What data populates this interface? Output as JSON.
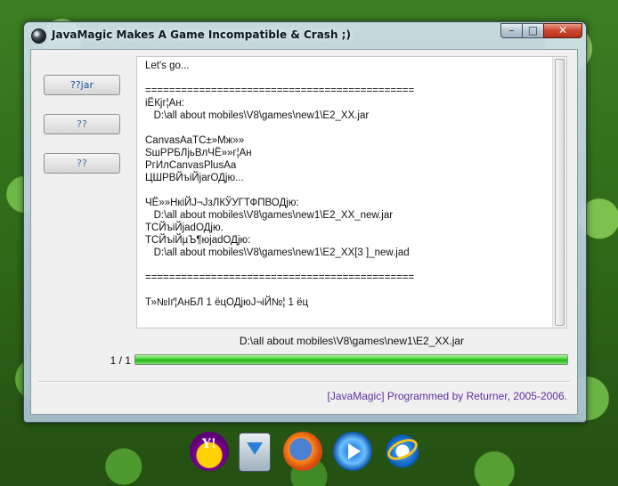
{
  "window": {
    "title": "JavaMagic Makes A Game Incompatible & Crash ;)",
    "controls": {
      "minimize": "–",
      "maximize": "□",
      "close": "✕"
    }
  },
  "sidebar": {
    "buttons": [
      {
        "label": "??jar"
      },
      {
        "label": "??"
      },
      {
        "label": "??"
      }
    ]
  },
  "log": {
    "lines": [
      "Let's go...",
      "",
      "=============================================",
      "іЁКјг¦Ан:",
      "   D:\\all about mobiles\\V8\\games\\new1\\E2_XX.jar",
      "",
      "CanvasAaTC±»Мж»»",
      "SшРРБЛјьВлЧЁ»»г¦Ан",
      "РгИлCanvasPlusAa",
      "ЦШРВЙъіЙjarОДјю...",
      "",
      "ЧЁ»»НкіЙЈ¬ЈзЛКЎУГТФПВОДјю:",
      "   D:\\all about mobiles\\V8\\games\\new1\\E2_XX_new.jar",
      "ТСЙъіЙjadОДјю.",
      "ТСЙъіЙµЪ¶юjadОДјю:",
      "   D:\\all about mobiles\\V8\\games\\new1\\E2_XX[3 ]_new.jad",
      "",
      "=============================================",
      "",
      "Т»№Іґ¦АнБЛ 1 ёцОДјюЈ¬іЙ№¦ 1 ёц"
    ]
  },
  "status": {
    "file_path": "D:\\all about mobiles\\V8\\games\\new1\\E2_XX.jar",
    "progress_count": "1 / 1",
    "progress_fraction": 1.0,
    "credit": "[JavaMagic] Programmed by Returner, 2005-2006."
  },
  "taskbar": {
    "icons": [
      "yahoo-messenger-icon",
      "download-manager-icon",
      "firefox-icon",
      "windows-media-player-icon",
      "internet-explorer-icon"
    ],
    "yahoo_label": "Y!"
  }
}
